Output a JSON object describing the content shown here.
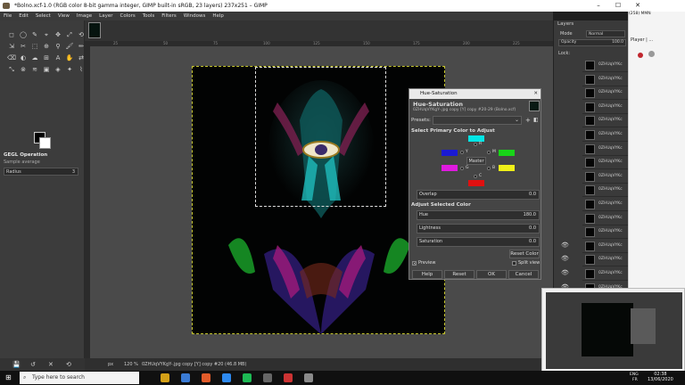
{
  "window": {
    "title": "*Bolno.xcf-1.0 (RGB color 8-bit gamma integer, GIMP built-in sRGB, 23 layers) 237x251 – GIMP"
  },
  "menu": [
    "File",
    "Edit",
    "Select",
    "View",
    "Image",
    "Layer",
    "Colors",
    "Tools",
    "Filters",
    "Windows",
    "Help"
  ],
  "tool_options": {
    "title": "GEGL Operation",
    "sample": "Sample average",
    "radius_label": "Radius",
    "radius_value": "3"
  },
  "rulers": {
    "top_ticks": [
      "25",
      "50",
      "75",
      "100",
      "125",
      "150",
      "175",
      "200",
      "225"
    ]
  },
  "status": {
    "unit": "px",
    "zoom": "120 %",
    "layer_info": "0ZHUqVYKgY-.jpg copy [Y] copy #20 (46.8 MB)"
  },
  "dialog": {
    "window_title": "Hue-Saturation",
    "heading": "Hue-Saturation",
    "subheading": "0ZHUqVYKgY-.jpg copy [Y] copy #20-29 (Bolno.xcf)",
    "presets_label": "Presets:",
    "select_primary": "Select Primary Color to Adjust",
    "colors": {
      "R": "#00e5e5",
      "Y": "#1a1ad4",
      "M": "#18d418",
      "G": "#e01ae0",
      "B": "#f0f018",
      "C": "#e01010"
    },
    "master_label": "Master",
    "overlap_label": "Overlap",
    "overlap_value": "0.0",
    "adjust_selected": "Adjust Selected Color",
    "hue_label": "Hue",
    "hue_value": "180.0",
    "lightness_label": "Lightness",
    "lightness_value": "0.0",
    "saturation_label": "Saturation",
    "saturation_value": "0.0",
    "reset_color": "Reset Color",
    "preview_label": "Preview",
    "split_view": "Split view",
    "help": "Help",
    "reset": "Reset",
    "ok": "OK",
    "cancel": "Cancel"
  },
  "layers": {
    "title": "Layers",
    "mode_label": "Mode",
    "mode_value": "Normal",
    "opacity_label": "Opacity",
    "opacity_value": "100.0",
    "lock_label": "Lock:",
    "row_name": "0ZHUqVYKc"
  },
  "chrome": {
    "tab": "(258) MMN",
    "player": "Player | ..."
  },
  "taskbar": {
    "search_placeholder": "Type here to search",
    "lang": "ENG",
    "region": "FR",
    "time": "02:38",
    "date": "13/06/2020"
  }
}
